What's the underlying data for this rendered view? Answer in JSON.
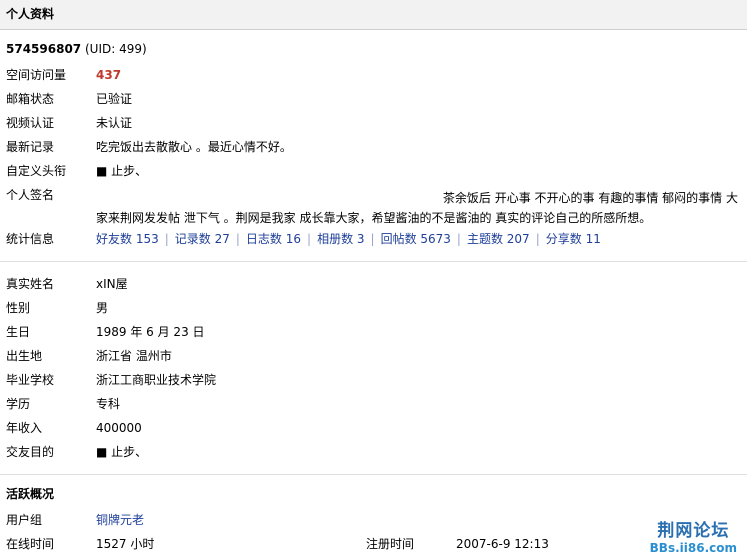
{
  "header": {
    "title": "个人资料"
  },
  "user": {
    "name": "574596807",
    "uid_text": "(UID: 499)"
  },
  "basic": {
    "visits_label": "空间访问量",
    "visits_value": "437",
    "email_label": "邮箱状态",
    "email_value": "已验证",
    "video_label": "视频认证",
    "video_value": "未认证",
    "recent_label": "最新记录",
    "recent_value": "吃完饭出去散散心 。最近心情不好。",
    "title_label": "自定义头衔",
    "title_value": "■ 止步、",
    "signature_label": "个人签名",
    "signature_line1": "茶余饭后 开心事 不开心的事  有趣的事情 郁闷的事情 大",
    "signature_line2": "家来荆网发发帖 泄下气 。荆网是我家 成长靠大家，希望酱油的不是酱油的 真实的评论自己的所感所想。",
    "stats_label": "统计信息",
    "stats": [
      "好友数 153",
      "记录数 27",
      "日志数 16",
      "相册数 3",
      "回帖数 5673",
      "主题数 207",
      "分享数 11"
    ],
    "stats_separator": "|"
  },
  "profile": {
    "realname_label": "真实姓名",
    "realname_value": "xIN屋",
    "gender_label": "性别",
    "gender_value": "男",
    "birthday_label": "生日",
    "birthday_value": "1989 年 6 月 23 日",
    "birthplace_label": "出生地",
    "birthplace_value": "浙江省 温州市",
    "school_label": "毕业学校",
    "school_value": "浙江工商职业技术学院",
    "education_label": "学历",
    "education_value": "专科",
    "income_label": "年收入",
    "income_value": "400000",
    "purpose_label": "交友目的",
    "purpose_value": "■ 止步、"
  },
  "activity": {
    "title": "活跃概况",
    "group_label": "用户组",
    "group_value": "铜牌元老",
    "online_label": "在线时间",
    "online_value": "1527 小时",
    "register_label": "注册时间",
    "register_value": "2007-6-9 12:13"
  },
  "watermark": {
    "line1": "荆网论坛",
    "line2": "BBs.ii86.com"
  }
}
